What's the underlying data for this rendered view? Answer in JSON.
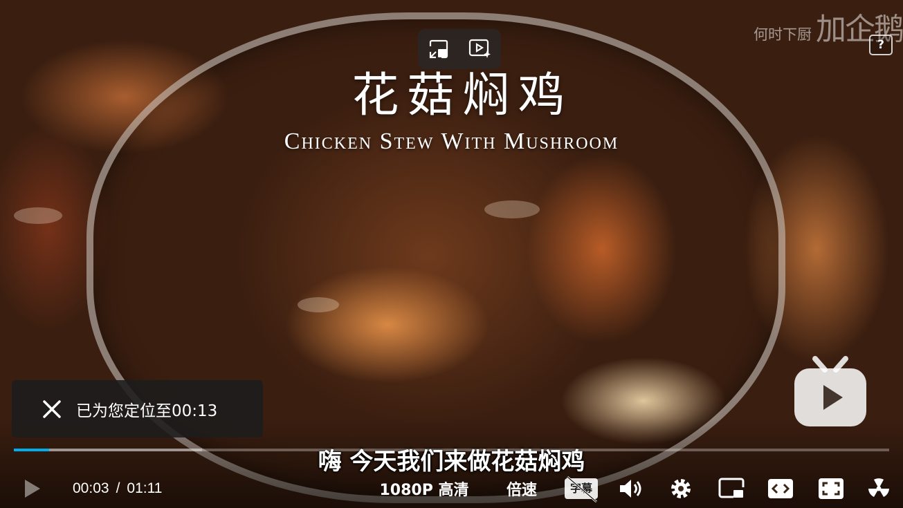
{
  "video": {
    "title_zh": "花菇焖鸡",
    "title_en": "Chicken Stew With Mushroom",
    "subtitle": "嗨 今天我们来做花菇焖鸡",
    "watermark": "何时下厨",
    "watermark_partial": "加企鹅",
    "progress_played": 0.04,
    "progress_buffered": 0.215,
    "accent_color": "#00aeec"
  },
  "toast": {
    "text": "已为您定位至00:13"
  },
  "controls": {
    "current_time": "00:03",
    "separator": "/",
    "duration": "01:11",
    "quality": "1080P 高清",
    "speed": "倍速",
    "subtitle_toggle": "字幕"
  },
  "icons": {
    "top_left": "pip-exit-icon",
    "top_right": "ai-video-icon",
    "report": "report-icon",
    "logo": "bilibili-tv-logo"
  }
}
